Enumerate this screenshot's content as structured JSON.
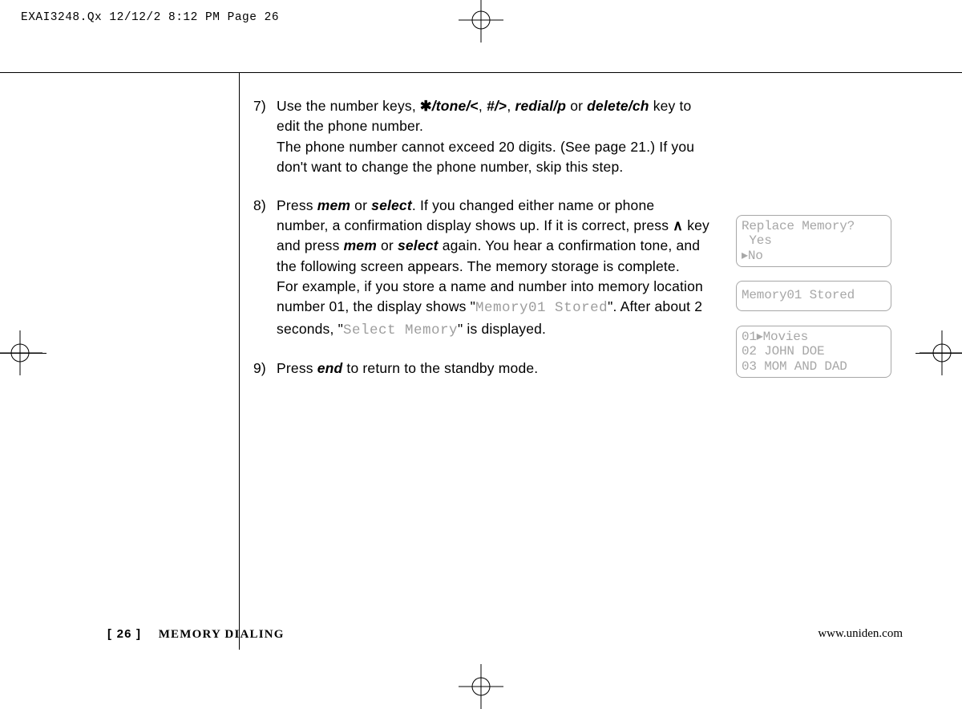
{
  "running_head": "EXAI3248.Qx  12/12/2  8:12 PM  Page 26",
  "steps": {
    "s7": {
      "num": "7)",
      "pre": "Use the number keys, ",
      "star": "✱",
      "k1": "/tone/",
      "lt": "<",
      "comma1": ", ",
      "k2": "#/",
      "gt": ">",
      "comma2": ", ",
      "k3": "redial/p",
      "or": " or ",
      "k4": "delete/ch",
      "tail": " key to edit the phone number.",
      "line2": "The phone number cannot exceed 20 digits. (See page 21.) If you don't want to change the phone number, skip this step."
    },
    "s8": {
      "num": "8)",
      "a": "Press ",
      "mem": "mem",
      "b": " or ",
      "select": "select",
      "c": ". If you changed either name or phone number, a confirmation display shows up. If it is correct, press ",
      "up": "∧",
      "d": " key and press ",
      "e": " or ",
      "f": " again. You hear a confirmation tone, and the following screen appears. The memory storage is complete.",
      "g": "For example, if you store a name and number into memory location number 01, the display shows \"",
      "lcd1": "Memory01 Stored",
      "h": "\". After about 2 seconds, \"",
      "lcd2": "Select Memory",
      "i": "\" is displayed."
    },
    "s9": {
      "num": "9)",
      "a": "Press ",
      "end": "end",
      "b": " to return to the standby mode."
    }
  },
  "lcd_boxes": {
    "replace": "Replace Memory?\n Yes\n▸No",
    "stored": "Memory01 Stored",
    "list": "01▸Movies\n02 JOHN DOE\n03 MOM AND DAD"
  },
  "footer": {
    "page": "[ 26 ]",
    "title": "MEMORY DIALING",
    "url": "www.uniden.com"
  }
}
